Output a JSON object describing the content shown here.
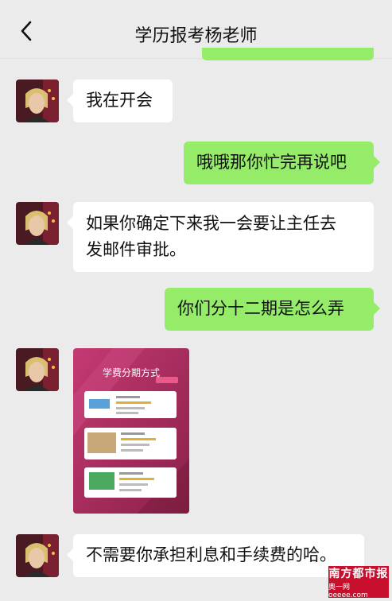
{
  "header": {
    "title": "学历报考杨老师"
  },
  "messages": [
    {
      "side": "left",
      "text": "我在开会"
    },
    {
      "side": "right",
      "text": "哦哦那你忙完再说吧"
    },
    {
      "side": "left",
      "text_line1": "如果你确定下来我一会要让主任去",
      "text_line2": "发邮件审批。"
    },
    {
      "side": "right",
      "text": "你们分十二期是怎么弄"
    },
    {
      "side": "left",
      "image_title": "学费分期方式"
    },
    {
      "side": "left",
      "text": "不需要你承担利息和手续费的哈。"
    }
  ],
  "watermark": {
    "line1": "南方都市报",
    "line2": "奥一网oeeee.com"
  },
  "colors": {
    "background": "#ebebeb",
    "incoming": "#ffffff",
    "outgoing": "#95ec69",
    "card": "#b8336a",
    "watermark": "#c8102e"
  }
}
